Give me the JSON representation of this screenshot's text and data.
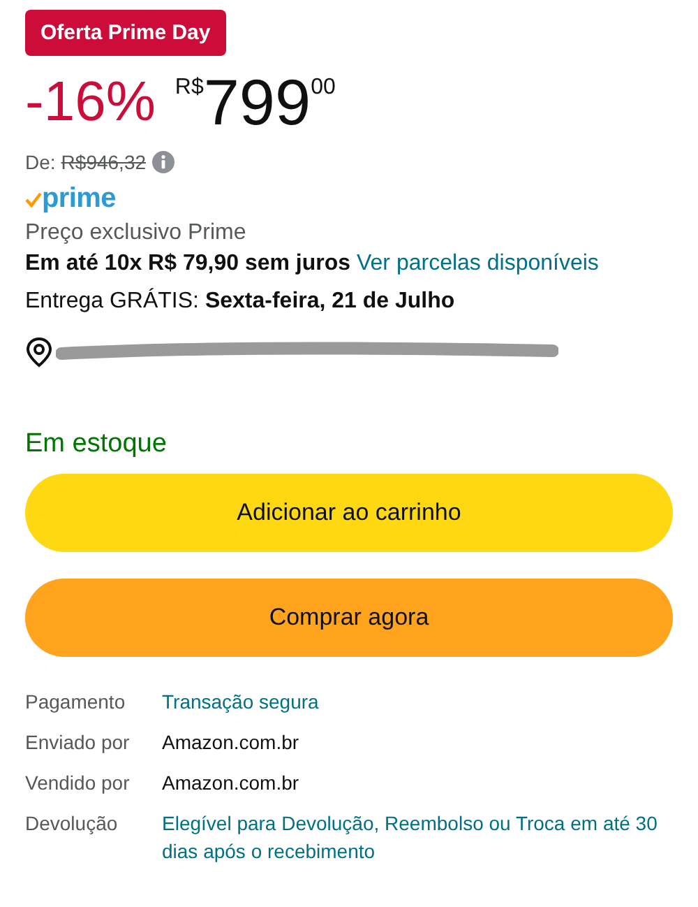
{
  "deal_badge": "Oferta Prime Day",
  "price": {
    "discount": "-16%",
    "currency": "R$",
    "whole": "799",
    "cents": "00"
  },
  "list_price": {
    "label": "De:",
    "value": "R$946,32"
  },
  "prime_logo": "prime",
  "prime_note": "Preço exclusivo Prime",
  "installments": {
    "text": "Em até 10x R$ 79,90 sem juros",
    "link": "Ver parcelas disponíveis"
  },
  "delivery": "Entrega GRÁTIS: **Sexta-feira, 21 de Julho**",
  "stock": "Em estoque",
  "buttons": [
    {
      "label": "Adicionar ao carrinho",
      "kind": "cart"
    },
    {
      "label": "Comprar agora",
      "kind": "buy"
    }
  ],
  "details": [
    {
      "label": "Pagamento",
      "value": "Transação segura",
      "kind": "link"
    },
    {
      "label": "Enviado por",
      "value": "Amazon.com.br",
      "kind": "text"
    },
    {
      "label": "Vendido por",
      "value": "Amazon.com.br",
      "kind": "text"
    },
    {
      "label": "Devolução",
      "value": "Elegível para Devolução, Reembolso ou Troca em até 30 dias após o recebimento",
      "kind": "link"
    }
  ]
}
